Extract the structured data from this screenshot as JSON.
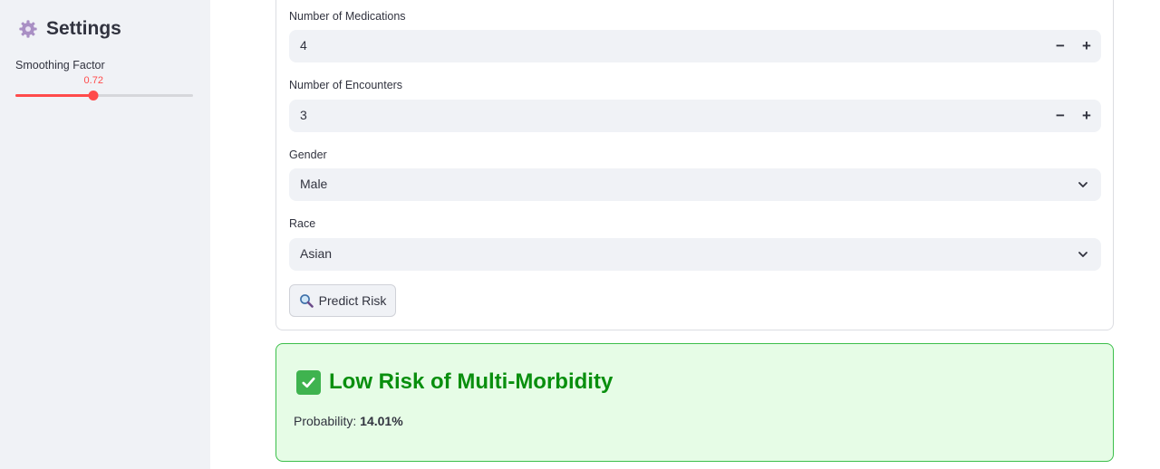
{
  "sidebar": {
    "title": "Settings",
    "title_icon": "gear-icon",
    "slider": {
      "label": "Smoothing Factor",
      "value": "0.72",
      "fraction": 0.44,
      "accent": "#ff4b4b"
    }
  },
  "form": {
    "medications": {
      "label": "Number of Medications",
      "value": "4",
      "decrement": "−",
      "increment": "+"
    },
    "encounters": {
      "label": "Number of Encounters",
      "value": "3",
      "decrement": "−",
      "increment": "+"
    },
    "gender": {
      "label": "Gender",
      "value": "Male"
    },
    "race": {
      "label": "Race",
      "value": "Asian"
    },
    "predict_button": {
      "label": "Predict Risk",
      "icon": "magnifier-icon"
    }
  },
  "result": {
    "icon": "check-mark-icon",
    "title": "Low Risk of Multi-Morbidity",
    "probability_label": "Probability:",
    "probability_value": "14.01%",
    "accent": "#098f0e",
    "background": "#e6fce6"
  }
}
